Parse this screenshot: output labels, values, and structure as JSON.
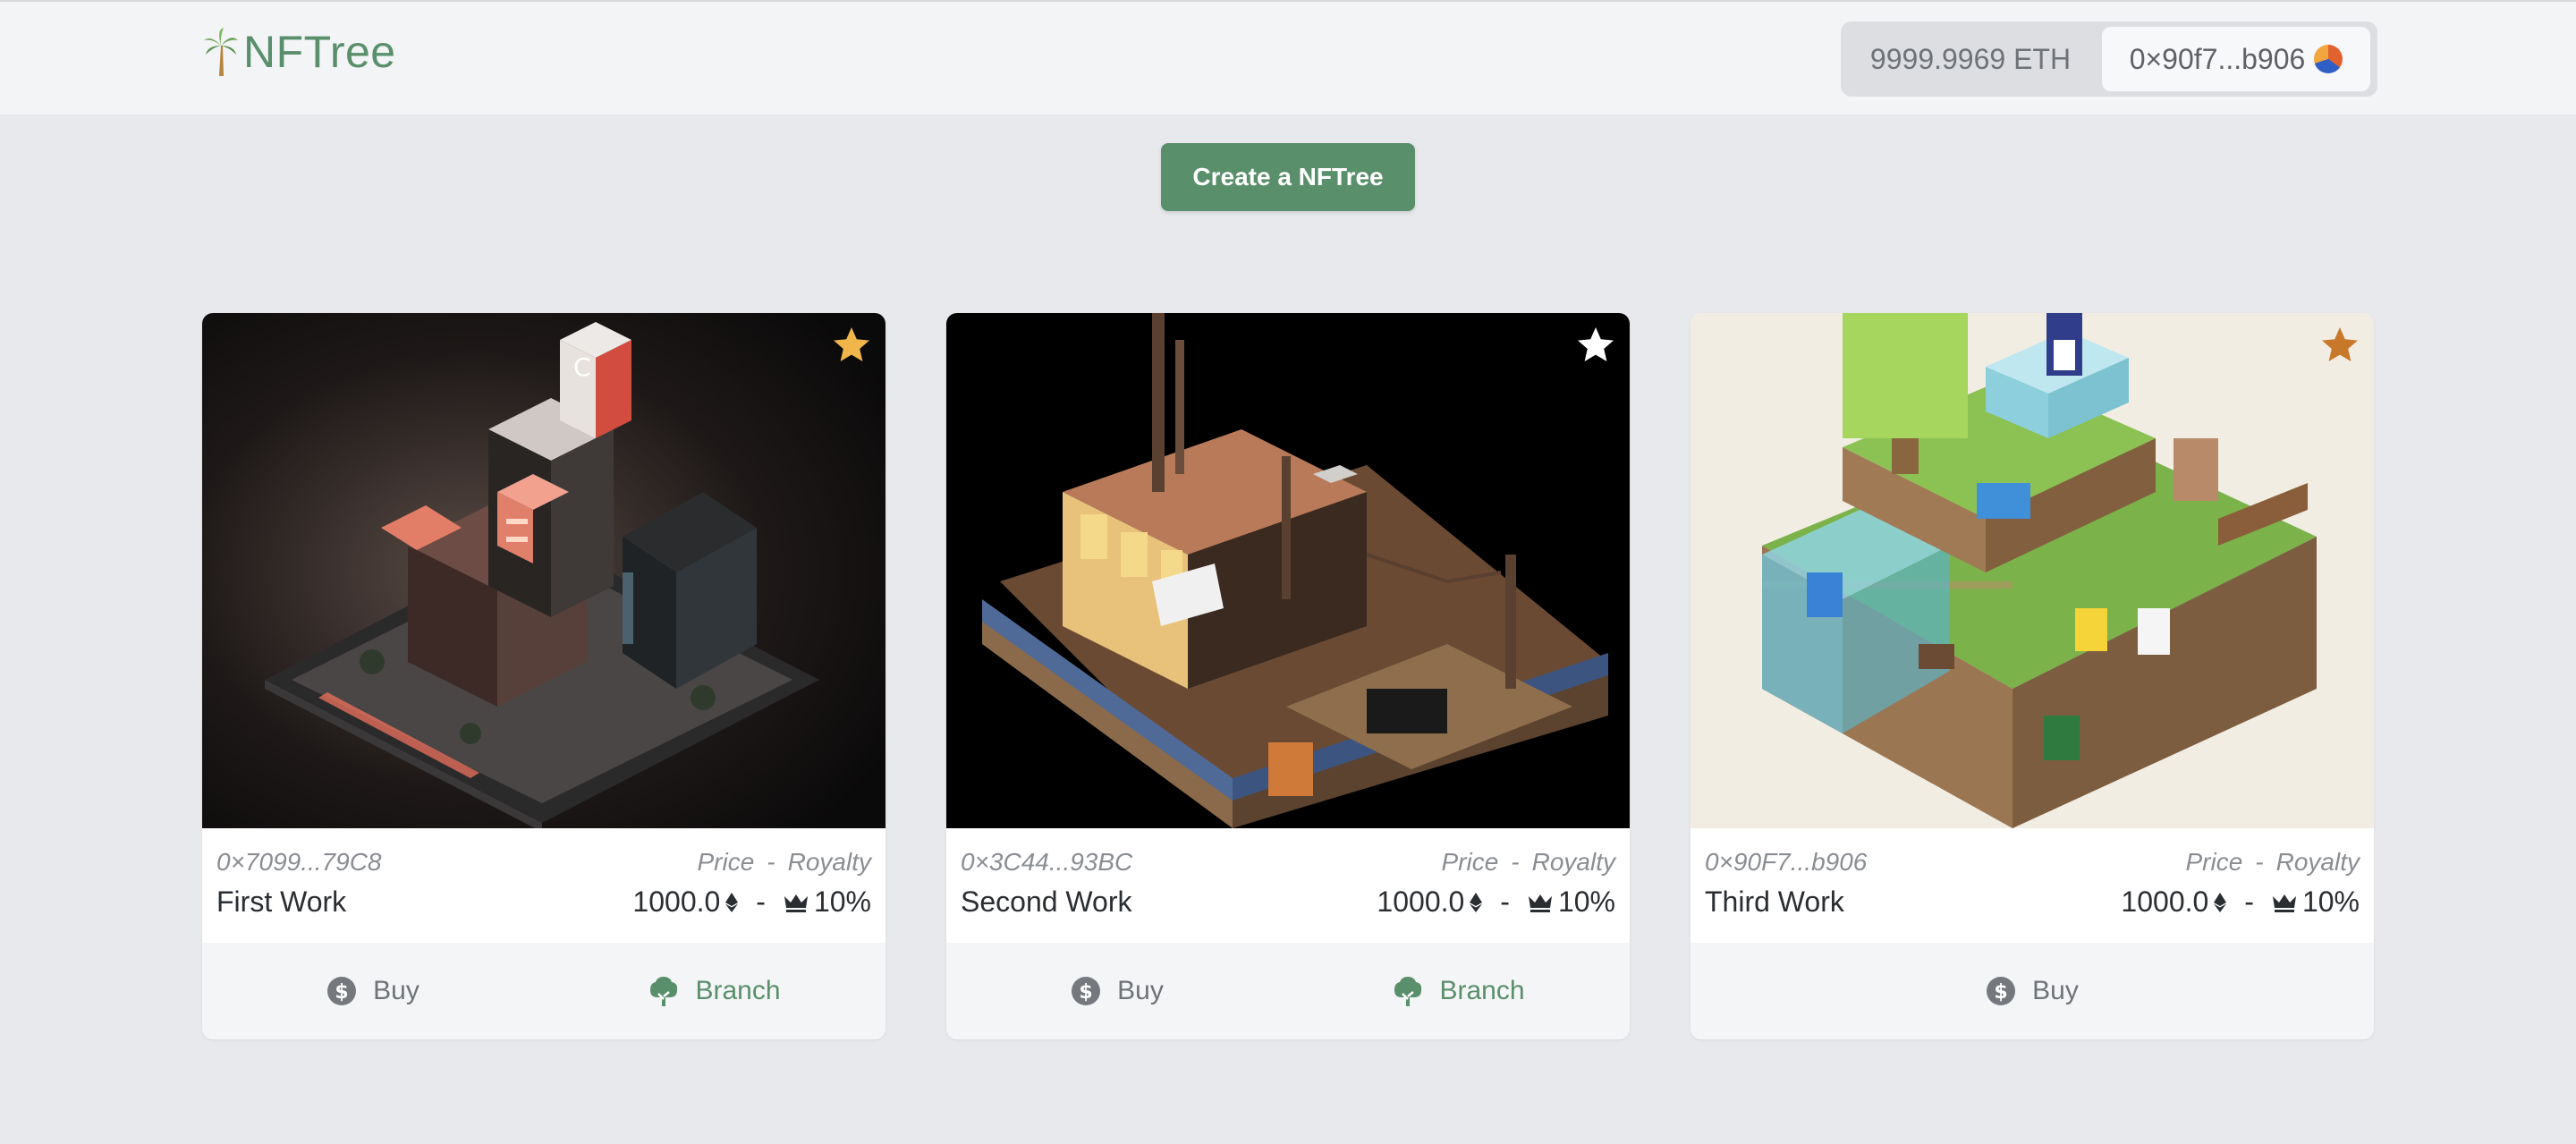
{
  "header": {
    "app_name": "NFTree",
    "balance": "9999.9969 ETH",
    "address": "0×90f7...b906"
  },
  "create_button_label": "Create a NFTree",
  "price_header": {
    "price": "Price",
    "dash": "-",
    "royalty": "Royalty"
  },
  "cards": [
    {
      "owner": "0×7099...79C8",
      "title": "First Work",
      "price": "1000.0",
      "royalty": "10%",
      "starred_color": "#f0b64a",
      "buy_label": "Buy",
      "branch_label": "Branch"
    },
    {
      "owner": "0×3C44...93BC",
      "title": "Second Work",
      "price": "1000.0",
      "royalty": "10%",
      "starred_color": "#ffffff",
      "buy_label": "Buy",
      "branch_label": "Branch"
    },
    {
      "owner": "0×90F7...b906",
      "title": "Third Work",
      "price": "1000.0",
      "royalty": "10%",
      "starred_color": "#c8782a",
      "buy_label": "Buy"
    }
  ],
  "colors": {
    "accent": "#5a8f6c",
    "background": "#e8e9ec"
  }
}
